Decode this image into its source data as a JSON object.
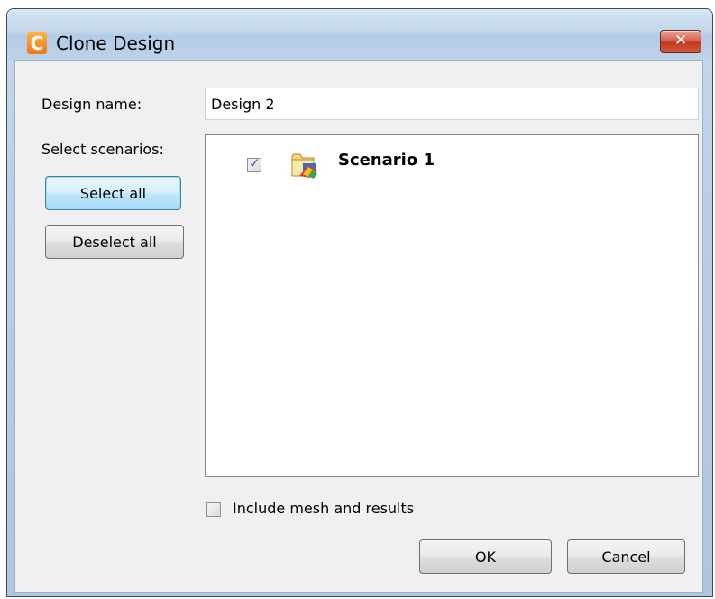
{
  "window": {
    "title": "Clone Design",
    "app_icon_letter": "C",
    "close_label": "✕"
  },
  "form": {
    "design_name_label": "Design name:",
    "design_name_value": "Design 2",
    "select_scenarios_label": "Select scenarios:",
    "select_all_label": "Select all",
    "deselect_all_label": "Deselect all"
  },
  "scenarios": [
    {
      "label": "Scenario 1",
      "checked": true
    }
  ],
  "options": {
    "include_mesh_label": "Include mesh and results",
    "include_mesh_checked": false
  },
  "footer": {
    "ok_label": "OK",
    "cancel_label": "Cancel"
  }
}
